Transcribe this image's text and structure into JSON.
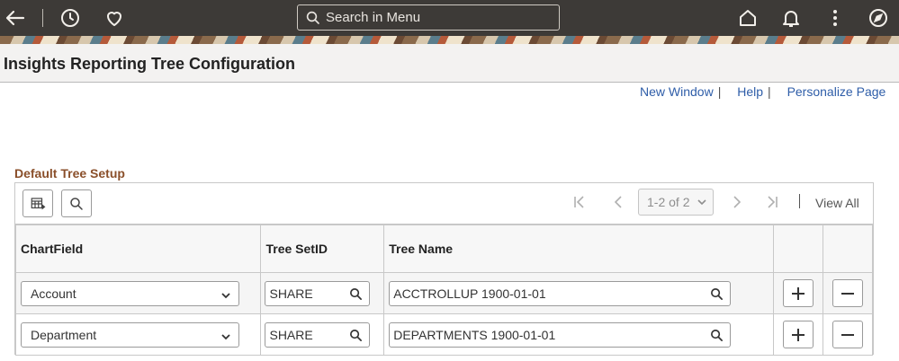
{
  "header": {
    "search_placeholder": "Search in Menu",
    "icons": [
      "back-icon",
      "history-icon",
      "favorites-icon",
      "home-icon",
      "notifications-icon",
      "actions-menu-icon",
      "navbar-icon"
    ]
  },
  "page": {
    "title": "Insights Reporting Tree Configuration"
  },
  "links": {
    "new_window": "New Window",
    "help": "Help",
    "personalize": "Personalize Page",
    "separator": "|"
  },
  "grid": {
    "section_title": "Default Tree Setup",
    "pager_value": "1-2 of 2",
    "view_all": "View All",
    "columns": {
      "chartfield": "ChartField",
      "tree_setid": "Tree SetID",
      "tree_name": "Tree Name"
    },
    "rows": [
      {
        "chartfield": "Account",
        "tree_setid": "SHARE",
        "tree_name": "ACCTROLLUP 1900-01-01"
      },
      {
        "chartfield": "Department",
        "tree_setid": "SHARE",
        "tree_name": "DEPARTMENTS 1900-01-01"
      }
    ]
  },
  "colors": {
    "header_bg": "#3d3a37",
    "link": "#2e5da8",
    "section_title": "#8a4f2a"
  }
}
